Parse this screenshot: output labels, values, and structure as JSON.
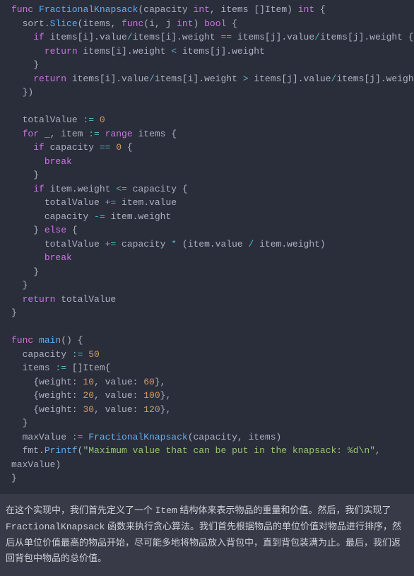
{
  "code": {
    "l0_kw_func": "func",
    "l0_fn": "FractionalKnapsack",
    "l0_p": "(",
    "l0_capacity": "capacity",
    "l0_int1": "int",
    "l0_items": ", items []",
    "l0_item": "Item",
    "l0_rp": ") ",
    "l0_int2": "int",
    "l0_brace": " {",
    "l1_indent": "  ",
    "l1_sort": "sort",
    "l1_dot": ".",
    "l1_slice": "Slice",
    "l1_p": "(items, ",
    "l1_func": "func",
    "l1_pi": "(i, j ",
    "l1_int": "int",
    "l1_rp": ") ",
    "l1_bool": "bool",
    "l1_brace": " {",
    "l2_indent": "    ",
    "l2_if": "if",
    "l2_cond_a": " items[i].value",
    "l2_op1": "/",
    "l2_cond_b": "items[i].weight ",
    "l2_eq": "==",
    "l2_cond_c": " items[j].value",
    "l2_op2": "/",
    "l2_cond_d": "items[j].weight {",
    "l3_indent": "      ",
    "l3_return": "return",
    "l3_a": " items[i].weight ",
    "l3_lt": "<",
    "l3_b": " items[j].weight",
    "l4": "    }",
    "l5_indent": "    ",
    "l5_return": "return",
    "l5_a": " items[i].value",
    "l5_op1": "/",
    "l5_b": "items[i].weight ",
    "l5_gt": ">",
    "l5_c": " items[j].value",
    "l5_op2": "/",
    "l5_d": "items[j].weight",
    "l6": "  })",
    "blank": "",
    "l8_indent": "  ",
    "l8_tv": "totalValue ",
    "l8_op": ":=",
    "l8_sp": " ",
    "l8_zero": "0",
    "l9_indent": "  ",
    "l9_for": "for",
    "l9_u": " _, item ",
    "l9_op": ":=",
    "l9_sp": " ",
    "l9_range": "range",
    "l9_items": " items {",
    "l10_indent": "    ",
    "l10_if": "if",
    "l10_cap": " capacity ",
    "l10_eq": "==",
    "l10_sp": " ",
    "l10_zero": "0",
    "l10_brace": " {",
    "l11_indent": "      ",
    "l11_break": "break",
    "l12": "    }",
    "l13_indent": "    ",
    "l13_if": "if",
    "l13_a": " item.weight ",
    "l13_le": "<=",
    "l13_b": " capacity {",
    "l14_indent": "      ",
    "l14_tv": "totalValue ",
    "l14_op": "+=",
    "l14_v": " item.value",
    "l15_indent": "      ",
    "l15_cap": "capacity ",
    "l15_op": "-=",
    "l15_v": " item.weight",
    "l16_indent": "    } ",
    "l16_else": "else",
    "l16_brace": " {",
    "l17_indent": "      ",
    "l17_tv": "totalValue ",
    "l17_op": "+=",
    "l17_a": " capacity ",
    "l17_mul": "*",
    "l17_b": " (item.value ",
    "l17_div": "/",
    "l17_c": " item.weight)",
    "l18_indent": "      ",
    "l18_break": "break",
    "l19": "    }",
    "l20": "  }",
    "l21_indent": "  ",
    "l21_return": "return",
    "l21_tv": " totalValue",
    "l22": "}",
    "m0_kw_func": "func",
    "m0_sp": " ",
    "m0_main": "main",
    "m0_p": "() {",
    "m1_indent": "  ",
    "m1_cap": "capacity ",
    "m1_op": ":=",
    "m1_sp": " ",
    "m1_50": "50",
    "m2_indent": "  ",
    "m2_items": "items ",
    "m2_op": ":=",
    "m2_v": " []Item{",
    "m3_indent": "    {weight: ",
    "m3_10": "10",
    "m3_c": ", value: ",
    "m3_60": "60",
    "m3_end": "},",
    "m4_indent": "    {weight: ",
    "m4_20": "20",
    "m4_c": ", value: ",
    "m4_100": "100",
    "m4_end": "},",
    "m5_indent": "    {weight: ",
    "m5_30": "30",
    "m5_c": ", value: ",
    "m5_120": "120",
    "m5_end": "},",
    "m6": "  }",
    "m7_indent": "  ",
    "m7_mv": "maxValue ",
    "m7_op": ":=",
    "m7_sp": " ",
    "m7_fn": "FractionalKnapsack",
    "m7_args": "(capacity, items)",
    "m8_indent": "  ",
    "m8_fmt": "fmt",
    "m8_dot": ".",
    "m8_printf": "Printf",
    "m8_p": "(",
    "m8_str": "\"Maximum value that can be put in the knapsack: %d\\n\"",
    "m8_rest": ", ",
    "m8_cont": "maxValue)",
    "m9": "}"
  },
  "desc": {
    "t1": "在这个实现中，我们首先定义了一个 ",
    "item": "Item",
    "t2": " 结构体来表示物品的重量和价值。然后，我们实现了 ",
    "fn": "FractionalKnapsack",
    "t3": " 函数来执行贪心算法。我们首先根据物品的单位价值对物品进行排序，然后从单位价值最高的物品开始，尽可能多地将物品放入背包中，直到背包装满为止。最后，我们返回背包中物品的总价值。"
  }
}
